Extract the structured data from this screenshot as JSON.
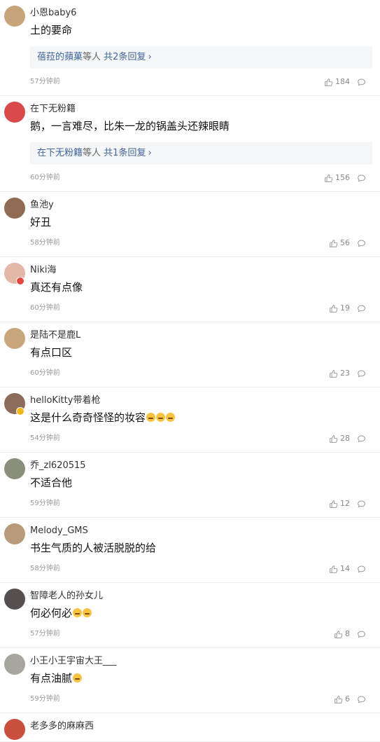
{
  "comments": [
    {
      "user": "小恩baby6",
      "text": "土的要命",
      "reply": {
        "users": "蓓菈的蘋菓",
        "suffix": "等人",
        "count": "共2条回复",
        "arrow": "›"
      },
      "time": "57分钟前",
      "likes": "184",
      "avatar_color": "#c7a47a",
      "emoji_count": 0
    },
    {
      "user": "在下无粉籍",
      "text": "鹅，一言难尽，比朱一龙的锅盖头还辣眼睛",
      "reply": {
        "users": "在下无粉籍",
        "suffix": "等人",
        "count": "共1条回复",
        "arrow": "›"
      },
      "time": "60分钟前",
      "likes": "156",
      "avatar_color": "#d94a4a",
      "emoji_count": 0
    },
    {
      "user": "鱼池y",
      "text": "好丑",
      "time": "58分钟前",
      "likes": "56",
      "avatar_color": "#8f6b54",
      "emoji_count": 0
    },
    {
      "user": "Niki海",
      "text": "真还有点像",
      "time": "60分钟前",
      "likes": "19",
      "avatar_color": "#e3b8a8",
      "badge_color": "#e8453c",
      "emoji_count": 0
    },
    {
      "user": "是陆不是鹿L",
      "text": "有点口区",
      "time": "60分钟前",
      "likes": "23",
      "avatar_color": "#c9a77c",
      "emoji_count": 0
    },
    {
      "user": "helloKitty带着枪",
      "text": "这是什么奇奇怪怪的妆容",
      "time": "54分钟前",
      "likes": "28",
      "avatar_color": "#8d6b5a",
      "badge_color": "#f3b71c",
      "emoji_count": 3
    },
    {
      "user": "乔_zl620515",
      "text": "不适合他",
      "time": "59分钟前",
      "likes": "12",
      "avatar_color": "#8a8f7c",
      "emoji_count": 0
    },
    {
      "user": "Melody_GMS",
      "text": "书生气质的人被活脱脱的给",
      "time": "58分钟前",
      "likes": "14",
      "avatar_color": "#b89a7a",
      "emoji_count": 0
    },
    {
      "user": "智障老人的孙女儿",
      "text": "何必何必",
      "time": "57分钟前",
      "likes": "8",
      "avatar_color": "#55504f",
      "emoji_count": 2
    },
    {
      "user": "小王小王宇宙大王___",
      "text": "有点油腻",
      "time": "59分钟前",
      "likes": "6",
      "avatar_color": "#a8a59e",
      "emoji_count": 1
    },
    {
      "user": "老多多的麻麻西",
      "text": "",
      "time": "",
      "likes": "",
      "avatar_color": "#c94f3f",
      "emoji_count": 0
    }
  ]
}
